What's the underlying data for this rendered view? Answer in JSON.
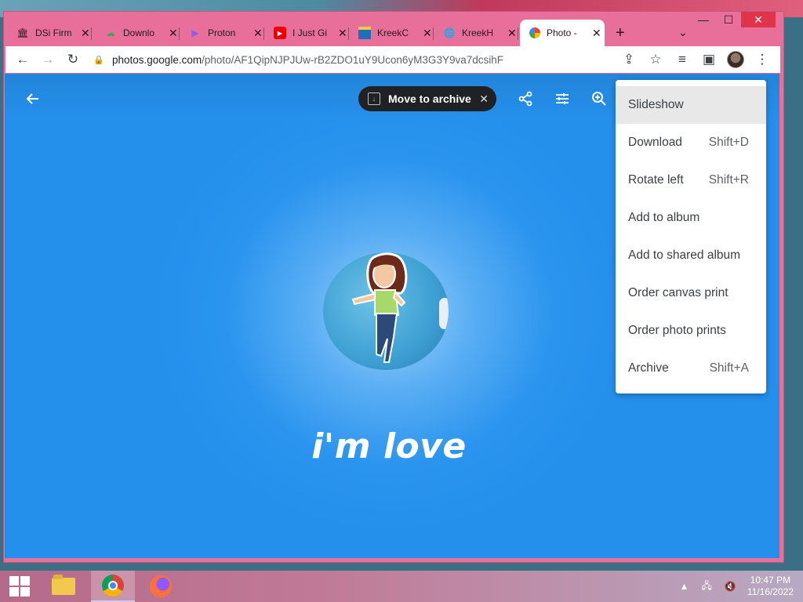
{
  "browser": {
    "tabs": [
      {
        "title": "DSi Firm",
        "icon": "bank-icon"
      },
      {
        "title": "Downlo",
        "icon": "cloud-icon"
      },
      {
        "title": "Proton",
        "icon": "proton-icon"
      },
      {
        "title": "I Just Gi",
        "icon": "youtube-icon"
      },
      {
        "title": "KreekC",
        "icon": "kreek-icon"
      },
      {
        "title": "KreekH",
        "icon": "globe-icon"
      },
      {
        "title": "Photo -",
        "icon": "google-photos-icon"
      }
    ],
    "url_host": "photos.google.com",
    "url_path": "/photo/AF1QipNJPJUw-rB2ZDO1uY9Ucon6yM3G3Y9va7dcsihF"
  },
  "viewer": {
    "archive_chip": "Move to archive",
    "caption": "i'm love"
  },
  "menu": {
    "items": [
      {
        "label": "Slideshow",
        "shortcut": ""
      },
      {
        "label": "Download",
        "shortcut": "Shift+D"
      },
      {
        "label": "Rotate left",
        "shortcut": "Shift+R"
      },
      {
        "label": "Add to album",
        "shortcut": ""
      },
      {
        "label": "Add to shared album",
        "shortcut": ""
      },
      {
        "label": "Order canvas print",
        "shortcut": ""
      },
      {
        "label": "Order photo prints",
        "shortcut": ""
      },
      {
        "label": "Archive",
        "shortcut": "Shift+A"
      }
    ]
  },
  "taskbar": {
    "time": "10:47 PM",
    "date": "11/16/2022"
  },
  "colors": {
    "browser_frame": "#e86f9a",
    "viewport_blue": "#2590ec",
    "chip_bg": "#202124"
  }
}
